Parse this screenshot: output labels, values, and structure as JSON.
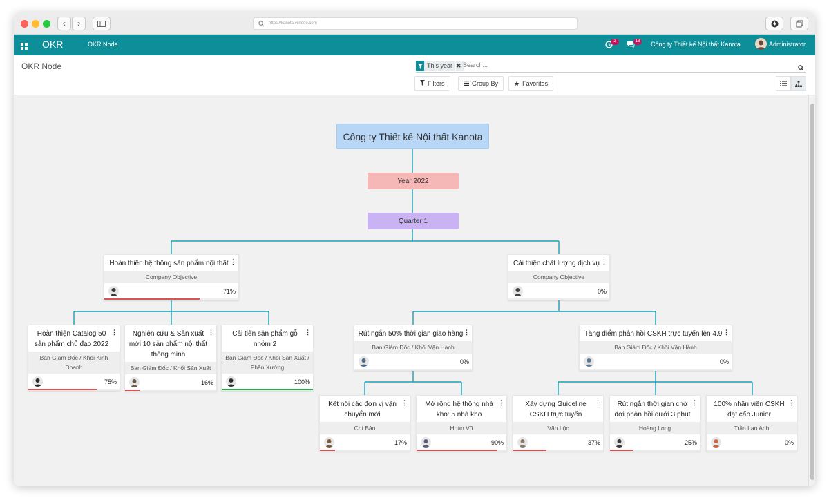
{
  "browser": {
    "url": "https://kanota.viindoo.com"
  },
  "navbar": {
    "app_name": "OKR",
    "menu_item": "OKR Node",
    "activity_count": "2",
    "message_count": "13",
    "company": "Công ty Thiết kế Nội thất Kanota",
    "user": "Administrator"
  },
  "control_panel": {
    "title": "OKR Node",
    "facet_value": "This year",
    "search_placeholder": "Search...",
    "filters_label": "Filters",
    "group_by_label": "Group By",
    "favorites_label": "Favorites"
  },
  "org": {
    "root": "Công ty Thiết kế Nội thất Kanota",
    "year": "Year 2022",
    "quarter": "Quarter 1"
  },
  "nodes": [
    {
      "title": "Hoàn thiện hệ thống sản phẩm nội thất",
      "subtitle": "Company Objective",
      "progress": "71%",
      "progress_value": 71,
      "bar_color": "#d9534f"
    },
    {
      "title": "Cải thiện chất lượng dịch vụ",
      "subtitle": "Company Objective",
      "progress": "0%",
      "progress_value": 0,
      "bar_color": "#d9534f"
    },
    {
      "title": "Hoàn thiện Catalog 50 sản phẩm chủ đạo 2022",
      "subtitle": "Ban Giám Đốc / Khối Kinh Doanh",
      "progress": "75%",
      "progress_value": 75,
      "bar_color": "#d9534f"
    },
    {
      "title": "Nghiên cứu & Sản xuất mới 10 sản phẩm nội thất thông minh",
      "subtitle": "Ban Giám Đốc / Khối Sản Xuất",
      "progress": "16%",
      "progress_value": 16,
      "bar_color": "#d9534f"
    },
    {
      "title": "Cải tiến sản phẩm gỗ nhóm 2",
      "subtitle": "Ban Giám Đốc / Khối Sản Xuất / Phân Xưởng",
      "progress": "100%",
      "progress_value": 100,
      "bar_color": "#28a745"
    },
    {
      "title": "Rút ngắn 50% thời gian giao hàng",
      "subtitle": "Ban Giám Đốc / Khối Vận Hành",
      "progress": "0%",
      "progress_value": 0,
      "bar_color": "#d9534f"
    },
    {
      "title": "Tăng điểm phản hồi CSKH trực tuyến lên 4.9",
      "subtitle": "Ban Giám Đốc / Khối Vận Hành",
      "progress": "0%",
      "progress_value": 0,
      "bar_color": "#d9534f"
    },
    {
      "title": "Kết nối các đơn vị vận chuyển mới",
      "subtitle": "Chí Bảo",
      "progress": "17%",
      "progress_value": 17,
      "bar_color": "#d9534f"
    },
    {
      "title": "Mở rộng hệ thống nhà kho: 5 nhà kho",
      "subtitle": "Hoàn Vũ",
      "progress": "90%",
      "progress_value": 90,
      "bar_color": "#d9534f"
    },
    {
      "title": "Xây dựng Guideline CSKH trực tuyến",
      "subtitle": "Văn Lộc",
      "progress": "37%",
      "progress_value": 37,
      "bar_color": "#d9534f"
    },
    {
      "title": "Rút ngắn thời gian chờ đợi phản hồi dưới 3 phút",
      "subtitle": "Hoàng Long",
      "progress": "25%",
      "progress_value": 25,
      "bar_color": "#d9534f"
    },
    {
      "title": "100% nhân viên CSKH đạt cấp Junior",
      "subtitle": "Trần Lan Anh",
      "progress": "0%",
      "progress_value": 0,
      "bar_color": "#d9534f"
    }
  ],
  "colors": {
    "navbar": "#0e8e99",
    "connector": "#17a2b8",
    "root": "#b8d7f6",
    "year": "#f6b7b7",
    "quarter": "#c9b3f2",
    "progress_red": "#d9534f",
    "progress_green": "#28a745"
  }
}
